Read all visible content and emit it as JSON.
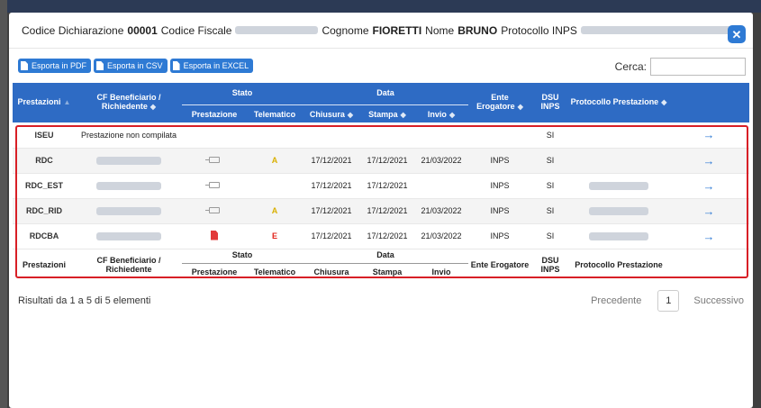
{
  "header": {
    "codice_label": "Codice Dichiarazione",
    "codice_value": "00001",
    "cf_label": "Codice Fiscale",
    "cognome_label": "Cognome",
    "cognome_value": "FIORETTI",
    "nome_label": "Nome",
    "nome_value": "BRUNO",
    "protocollo_label": "Protocollo INPS",
    "close_glyph": "✕"
  },
  "toolbar": {
    "export_pdf": "Esporta in PDF",
    "export_csv": "Esporta in CSV",
    "export_excel": "Esporta in EXCEL",
    "search_label": "Cerca:",
    "search_value": ""
  },
  "columns": {
    "prestazioni": "Prestazioni",
    "cf": "CF Beneficiario / Richiedente",
    "stato": "Stato",
    "prestazione": "Prestazione",
    "telematico": "Telematico",
    "data": "Data",
    "chiusura": "Chiusura",
    "stampa": "Stampa",
    "invio": "Invio",
    "ente": "Ente Erogatore",
    "dsu": "DSU INPS",
    "protocollo": "Protocollo Prestazione"
  },
  "rows": [
    {
      "prestazione": "ISEU",
      "cf_text": "Prestazione non compilata",
      "telematico": "",
      "chiusura": "",
      "stampa": "",
      "invio": "",
      "ente": "",
      "dsu": "SI",
      "stato_icon": "none"
    },
    {
      "prestazione": "RDC",
      "cf_text": "",
      "telematico": "A",
      "chiusura": "17/12/2021",
      "stampa": "17/12/2021",
      "invio": "21/03/2022",
      "ente": "INPS",
      "dsu": "SI",
      "stato_icon": "envelope-icon"
    },
    {
      "prestazione": "RDC_EST",
      "cf_text": "",
      "telematico": "",
      "chiusura": "17/12/2021",
      "stampa": "17/12/2021",
      "invio": "",
      "ente": "INPS",
      "dsu": "SI",
      "stato_icon": "envelope-icon"
    },
    {
      "prestazione": "RDC_RID",
      "cf_text": "",
      "telematico": "A",
      "chiusura": "17/12/2021",
      "stampa": "17/12/2021",
      "invio": "21/03/2022",
      "ente": "INPS",
      "dsu": "SI",
      "stato_icon": "envelope-icon"
    },
    {
      "prestazione": "RDCBA",
      "cf_text": "",
      "telematico": "E",
      "chiusura": "17/12/2021",
      "stampa": "17/12/2021",
      "invio": "21/03/2022",
      "ente": "INPS",
      "dsu": "SI",
      "stato_icon": "pdf-icon"
    }
  ],
  "row_arrow": "→",
  "footer": {
    "info": "Risultati da 1 a 5 di 5 elementi",
    "prev": "Precedente",
    "page": "1",
    "next": "Successivo"
  },
  "colors": {
    "accent": "#2e7ad4",
    "table_header": "#2e6bc4",
    "highlight_outline": "#d81f26",
    "telematico_a": "#d9b000",
    "telematico_e": "#e2231a"
  }
}
